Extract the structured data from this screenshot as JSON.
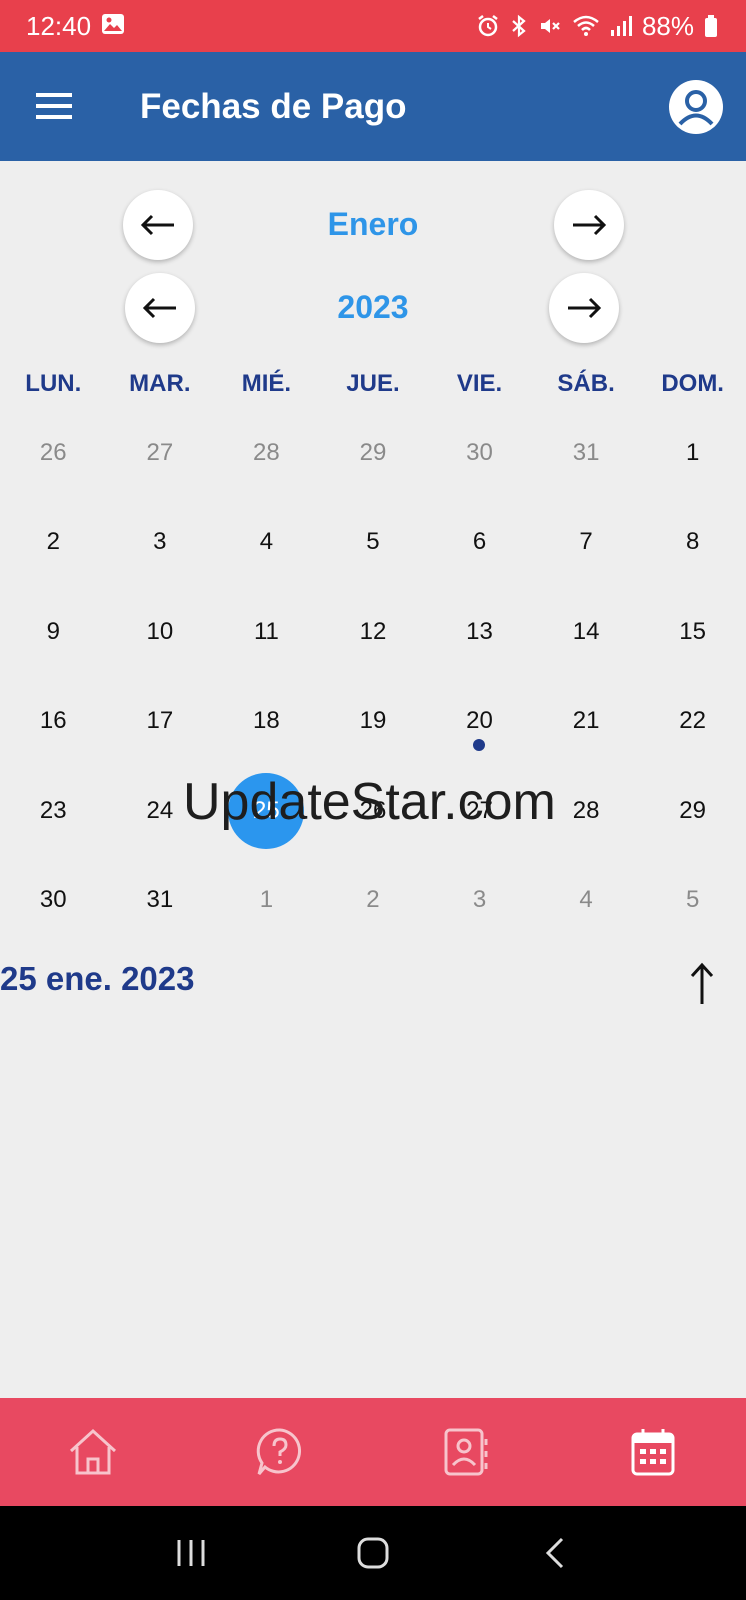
{
  "status_bar": {
    "time": "12:40",
    "battery": "88%"
  },
  "app_bar": {
    "title": "Fechas de Pago"
  },
  "calendar": {
    "month": "Enero",
    "year": "2023",
    "weekdays": [
      "LUN.",
      "MAR.",
      "MIÉ.",
      "JUE.",
      "VIE.",
      "SÁB.",
      "DOM."
    ],
    "weeks": [
      [
        {
          "d": "26",
          "out": true
        },
        {
          "d": "27",
          "out": true
        },
        {
          "d": "28",
          "out": true
        },
        {
          "d": "29",
          "out": true
        },
        {
          "d": "30",
          "out": true
        },
        {
          "d": "31",
          "out": true
        },
        {
          "d": "1"
        }
      ],
      [
        {
          "d": "2"
        },
        {
          "d": "3"
        },
        {
          "d": "4"
        },
        {
          "d": "5"
        },
        {
          "d": "6"
        },
        {
          "d": "7"
        },
        {
          "d": "8"
        }
      ],
      [
        {
          "d": "9"
        },
        {
          "d": "10"
        },
        {
          "d": "11"
        },
        {
          "d": "12"
        },
        {
          "d": "13"
        },
        {
          "d": "14"
        },
        {
          "d": "15"
        }
      ],
      [
        {
          "d": "16"
        },
        {
          "d": "17"
        },
        {
          "d": "18"
        },
        {
          "d": "19"
        },
        {
          "d": "20",
          "event": true
        },
        {
          "d": "21"
        },
        {
          "d": "22"
        }
      ],
      [
        {
          "d": "23"
        },
        {
          "d": "24"
        },
        {
          "d": "25",
          "selected": true
        },
        {
          "d": "26"
        },
        {
          "d": "27"
        },
        {
          "d": "28"
        },
        {
          "d": "29"
        }
      ],
      [
        {
          "d": "30"
        },
        {
          "d": "31"
        },
        {
          "d": "1",
          "out": true
        },
        {
          "d": "2",
          "out": true
        },
        {
          "d": "3",
          "out": true
        },
        {
          "d": "4",
          "out": true
        },
        {
          "d": "5",
          "out": true
        }
      ]
    ],
    "selected_date_label": "25 ene. 2023"
  },
  "watermark": "UpdateStar.com",
  "bottom_nav": {
    "tabs": [
      {
        "name": "home-icon"
      },
      {
        "name": "help-icon"
      },
      {
        "name": "contacts-icon"
      },
      {
        "name": "calendar-icon",
        "active": true
      }
    ]
  },
  "colors": {
    "status_bar": "#e8404c",
    "app_bar": "#2a61a6",
    "accent": "#2e95e8",
    "weekday": "#1f3a8a",
    "bottom_nav": "#e84961"
  }
}
